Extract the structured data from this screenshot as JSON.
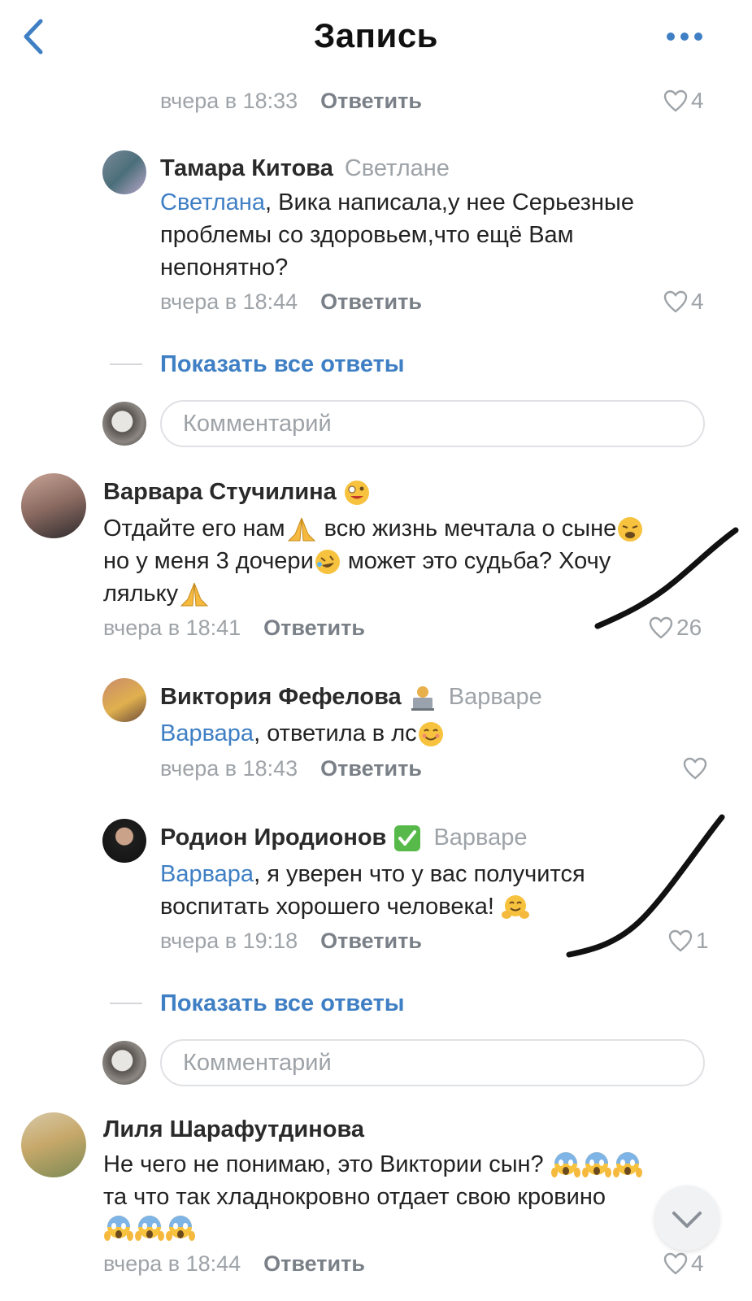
{
  "header": {
    "title": "Запись",
    "back_icon": "chevron-left-icon",
    "more_icon": "more-dots-icon",
    "accent": "#3f7fc4"
  },
  "comments": [
    {
      "time": "вчера в 18:33",
      "reply": "Ответить",
      "likes": "4"
    },
    {
      "author": "Тамара Китова",
      "to": "Светлане",
      "mention": "Светлана",
      "line1": ", Вика написала,у нее Серьезные",
      "line2": "проблемы со здоровьем,что ещё Вам",
      "line3": "непонятно?",
      "time": "вчера в 18:44",
      "reply": "Ответить",
      "likes": "4"
    },
    {
      "author": "Варвара Стучилина",
      "line1a": "Отдайте его нам",
      "line1b": " всю жизнь мечтала о сыне",
      "line2a": "но у меня 3 дочери",
      "line2b": " может это судьба? Хочу",
      "line3": "ляльку",
      "time": "вчера в 18:41",
      "reply": "Ответить",
      "likes": "26"
    },
    {
      "author": "Виктория Фефелова",
      "to": "Варваре",
      "mention": "Варвара",
      "line1": ", ответила в лс",
      "time": "вчера в 18:43",
      "reply": "Ответить",
      "likes": ""
    },
    {
      "author": "Родион Иродионов",
      "to": "Варваре",
      "mention": "Варвара",
      "line1": ", я уверен что у вас получится",
      "line2": "воспитать хорошего человека! ",
      "time": "вчера в 19:18",
      "reply": "Ответить",
      "likes": "1"
    },
    {
      "author": "Лиля Шарафутдинова",
      "line1": "Не чего не понимаю, это Виктории сын? ",
      "line2": "та что так хладнокровно отдает свою кровино",
      "time": "вчера в 18:44",
      "reply": "Ответить",
      "likes": "4"
    }
  ],
  "show_all_1": "Показать все ответы",
  "show_all_2": "Показать все ответы",
  "comment_placeholder_1": "Комментарий",
  "comment_placeholder_2": "Комментарий"
}
